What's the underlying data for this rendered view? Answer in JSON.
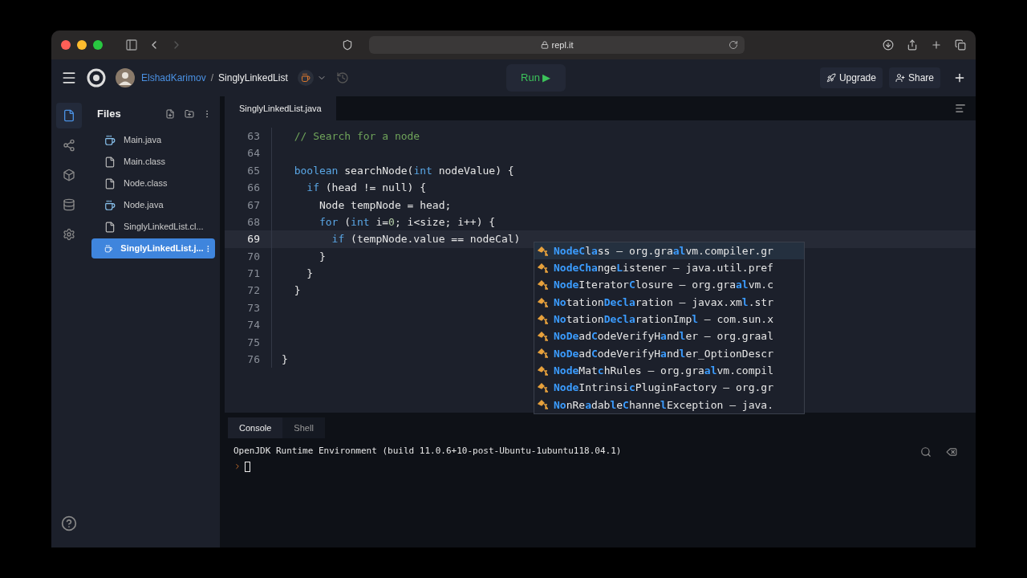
{
  "browser": {
    "address": "repl.it"
  },
  "header": {
    "user": "ElshadKarimov",
    "separator": "/",
    "repl": "SinglyLinkedList",
    "run": "Run ▶",
    "upgrade": "Upgrade",
    "share": "Share"
  },
  "sidebar": {
    "title": "Files",
    "files": [
      {
        "name": "Main.java",
        "kind": "java",
        "selected": false
      },
      {
        "name": "Main.class",
        "kind": "file",
        "selected": false
      },
      {
        "name": "Node.class",
        "kind": "file",
        "selected": false
      },
      {
        "name": "Node.java",
        "kind": "java",
        "selected": false
      },
      {
        "name": "SinglyLinkedList.cl...",
        "kind": "file",
        "selected": false
      },
      {
        "name": "SinglyLinkedList.j...",
        "kind": "java",
        "selected": true
      }
    ]
  },
  "editor": {
    "tab": "SinglyLinkedList.java",
    "lines": [
      {
        "number": "63",
        "active": false,
        "tokens": [
          {
            "kind": "comment",
            "text": "  // Search for a node"
          }
        ]
      },
      {
        "number": "64",
        "active": false
      },
      {
        "number": "65",
        "active": false,
        "tokens": [
          {
            "kind": "keyword",
            "text": "  boolean"
          },
          {
            "kind": "plain",
            "text": " searchNode("
          },
          {
            "kind": "keyword",
            "text": "int"
          },
          {
            "kind": "plain",
            "text": " nodeValue) {"
          }
        ]
      },
      {
        "number": "66",
        "active": false,
        "tokens": [
          {
            "kind": "keyword",
            "text": "    if"
          },
          {
            "kind": "plain",
            "text": " (head != null) {"
          }
        ]
      },
      {
        "number": "67",
        "active": false,
        "tokens": [
          {
            "kind": "plain",
            "text": "      Node tempNode = head;"
          }
        ]
      },
      {
        "number": "68",
        "active": false,
        "tokens": [
          {
            "kind": "keyword",
            "text": "      for"
          },
          {
            "kind": "plain",
            "text": " ("
          },
          {
            "kind": "keyword",
            "text": "int"
          },
          {
            "kind": "plain",
            "text": " i="
          },
          {
            "kind": "number",
            "text": "0"
          },
          {
            "kind": "plain",
            "text": "; i<size; i++) {"
          }
        ]
      },
      {
        "number": "69",
        "active": true,
        "tokens": [
          {
            "kind": "keyword",
            "text": "        if"
          },
          {
            "kind": "plain",
            "text": " (tempNode.value == nodeCal)"
          }
        ]
      },
      {
        "number": "70",
        "active": false,
        "tokens": [
          {
            "kind": "plain",
            "text": "      }"
          }
        ]
      },
      {
        "number": "71",
        "active": false,
        "tokens": [
          {
            "kind": "plain",
            "text": "    }"
          }
        ]
      },
      {
        "number": "72",
        "active": false,
        "tokens": [
          {
            "kind": "plain",
            "text": "  }"
          }
        ]
      },
      {
        "number": "73",
        "active": false
      },
      {
        "number": "74",
        "active": false
      },
      {
        "number": "75",
        "active": false
      },
      {
        "number": "76",
        "active": false,
        "tokens": [
          {
            "kind": "plain",
            "text": "}"
          }
        ]
      }
    ],
    "suggestions": [
      {
        "label": "**NodeC**l**a**ss",
        "detail": "– org.gra**al**vm.compiler.gr",
        "selected": true
      },
      {
        "label": "**NodeCha**nge**L**istener",
        "detail": "– java.util.pref",
        "selected": false
      },
      {
        "label": "**Node**Iterator**C**losure",
        "detail": "– org.gra**al**vm.c",
        "selected": false
      },
      {
        "label": "**No**tation**Decla**ration",
        "detail": "– javax.xm**l**.str",
        "selected": false
      },
      {
        "label": "**No**tation**Decla**rationImp**l**",
        "detail": "– com.sun.x",
        "selected": false
      },
      {
        "label": "**NoDe**ad**C**odeVerifyH**a**nd**l**er",
        "detail": "– org.graal",
        "selected": false
      },
      {
        "label": "**NoDe**ad**C**odeVerifyH**a**nd**l**er_OptionDescr",
        "selected": false
      },
      {
        "label": "**Node**Mat**c**hRules",
        "detail": "– org.gra**al**vm.compil",
        "selected": false
      },
      {
        "label": "**Node**Intrinsi**c**PluginFactory",
        "detail": "– org.gr",
        "selected": false
      },
      {
        "label": "**No**nRe**a**dab**l**e**C**hanne**l**Exception",
        "detail": "– java.",
        "selected": false
      }
    ]
  },
  "console": {
    "tabs": [
      {
        "label": "Console",
        "selected": true
      },
      {
        "label": "Shell",
        "selected": false
      }
    ],
    "output": "OpenJDK Runtime Environment (build 11.0.6+10-post-Ubuntu-1ubuntu118.04.1)"
  }
}
